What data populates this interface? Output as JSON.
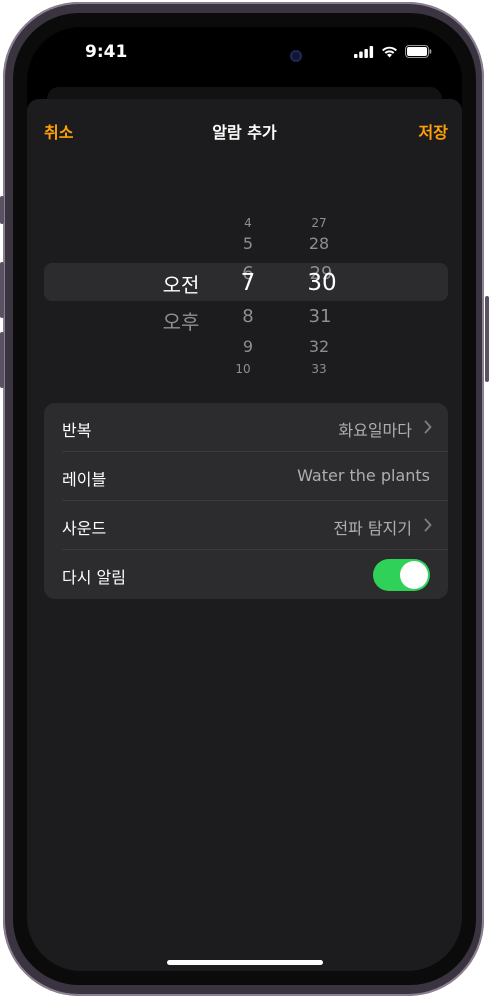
{
  "status_bar": {
    "time": "9:41"
  },
  "nav": {
    "cancel": "취소",
    "title": "알람 추가",
    "save": "저장"
  },
  "picker": {
    "ampm": {
      "selected": "오전",
      "below": "오후"
    },
    "hours": [
      "4",
      "5",
      "6",
      "7",
      "8",
      "9",
      "10"
    ],
    "minutes": [
      "27",
      "28",
      "29",
      "30",
      "31",
      "32",
      "33"
    ],
    "selected_hour": "7",
    "selected_minute": "30"
  },
  "settings": {
    "repeat": {
      "label": "반복",
      "value": "화요일마다"
    },
    "label": {
      "label": "레이블",
      "value": "Water the plants"
    },
    "sound": {
      "label": "사운드",
      "value": "전파 탐지기"
    },
    "snooze": {
      "label": "다시 알림",
      "on": true
    }
  },
  "colors": {
    "accent": "#ff9f0a",
    "toggle_on": "#30d158",
    "sheet_bg": "#1c1c1e",
    "cell_bg": "#2c2c2e"
  }
}
